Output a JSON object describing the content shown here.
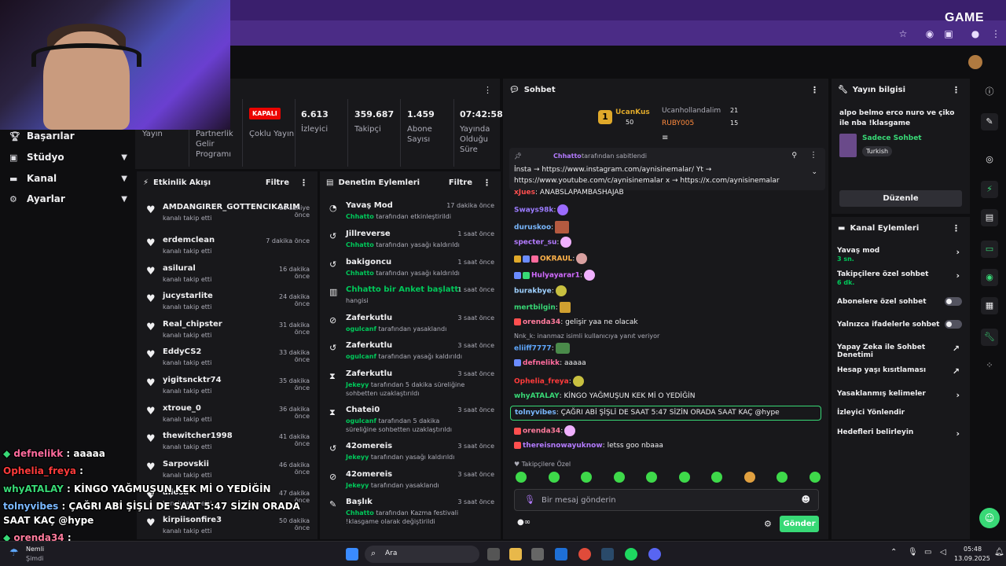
{
  "browser": {
    "logo_text": "GAME"
  },
  "leftnav": {
    "items": [
      {
        "label": "Başarılar",
        "icon": "trophy-icon"
      },
      {
        "label": "Stüdyo",
        "icon": "studio-icon"
      },
      {
        "label": "Kanal",
        "icon": "channel-icon"
      },
      {
        "label": "Ayarlar",
        "icon": "gear-icon"
      }
    ]
  },
  "stats": {
    "yayin": "Yayın",
    "partnerlik": "Partnerlik Gelir Programı",
    "kapali": "KAPALI",
    "coklu": "Çoklu Yayın",
    "izleyici_val": "6.613",
    "izleyici_lbl": "İzleyici",
    "takipci_val": "359.687",
    "takipci_lbl": "Takipçi",
    "abone_val": "1.459",
    "abone_lbl": "Abone Sayısı",
    "sure_val": "07:42:58",
    "sure_lbl": "Yayında Olduğu Süre"
  },
  "activity": {
    "title": "Etkinlik Akışı",
    "filter": "Filtre",
    "rows": [
      {
        "name": "AMDANGIRER_GOTTENCIKARIM",
        "sub": "kanalı takip etti",
        "time": "20 saniye önce"
      },
      {
        "name": "erdemclean",
        "sub": "kanalı takip etti",
        "time": "7 dakika önce"
      },
      {
        "name": "asilural",
        "sub": "kanalı takip etti",
        "time": "16 dakika önce"
      },
      {
        "name": "jucystarlite",
        "sub": "kanalı takip etti",
        "time": "24 dakika önce"
      },
      {
        "name": "Real_chipster",
        "sub": "kanalı takip etti",
        "time": "31 dakika önce"
      },
      {
        "name": "EddyCS2",
        "sub": "kanalı takip etti",
        "time": "33 dakika önce"
      },
      {
        "name": "yigitsncktr74",
        "sub": "kanalı takip etti",
        "time": "35 dakika önce"
      },
      {
        "name": "xtroue_0",
        "sub": "kanalı takip etti",
        "time": "36 dakika önce"
      },
      {
        "name": "thewitcher1998",
        "sub": "kanalı takip etti",
        "time": "41 dakika önce"
      },
      {
        "name": "Sarpovskii",
        "sub": "kanalı takip etti",
        "time": "46 dakika önce"
      },
      {
        "name": "aliosa",
        "sub": "kanalı takip etti",
        "time": "47 dakika önce"
      },
      {
        "name": "kirpiisonfire3",
        "sub": "kanalı takip etti",
        "time": "50 dakika önce"
      }
    ]
  },
  "moderation": {
    "title": "Denetim Eylemleri",
    "filter": "Filtre",
    "rows": [
      {
        "name": "Yavaş Mod",
        "actor": "Chhatto",
        "rest": "tarafından etkinleştirildi",
        "time": "17 dakika önce",
        "icon": "slow-mode-icon"
      },
      {
        "name": "Jillreverse",
        "actor": "Chhatto",
        "rest": "tarafından yasağı kaldırıldı",
        "time": "1 saat önce",
        "icon": "undo-icon"
      },
      {
        "name": "bakigoncu",
        "actor": "Chhatto",
        "rest": "tarafından yasağı kaldırıldı",
        "time": "1 saat önce",
        "icon": "undo-icon"
      },
      {
        "name": "Chhatto bir Anket başlattı",
        "actor": "",
        "rest": "hangisi",
        "time": "1 saat önce",
        "icon": "poll-icon"
      },
      {
        "name": "Zaferkutlu",
        "actor": "ogulcanf",
        "rest": "tarafından yasaklandı",
        "time": "3 saat önce",
        "icon": "ban-icon"
      },
      {
        "name": "Zaferkutlu",
        "actor": "ogulcanf",
        "rest": "tarafından yasağı kaldırıldı",
        "time": "3 saat önce",
        "icon": "undo-icon"
      },
      {
        "name": "Zaferkutlu",
        "actor": "Jekeyy",
        "rest": "tarafından 5 dakika süreliğine sohbetten uzaklaştırıldı",
        "time": "3 saat önce",
        "icon": "timeout-icon"
      },
      {
        "name": "Chatei0",
        "actor": "ogulcanf",
        "rest": "tarafından 5 dakika süreliğine sohbetten uzaklaştırıldı",
        "time": "3 saat önce",
        "icon": "timeout-icon"
      },
      {
        "name": "42omereis",
        "actor": "Jekeyy",
        "rest": "tarafından yasağı kaldırıldı",
        "time": "3 saat önce",
        "icon": "undo-icon"
      },
      {
        "name": "42omereis",
        "actor": "Jekeyy",
        "rest": "tarafından yasaklandı",
        "time": "3 saat önce",
        "icon": "ban-icon"
      },
      {
        "name": "Başlık",
        "actor": "Chhatto",
        "rest": "tarafından Kazma festivali !klasgame olarak değiştirildi",
        "time": "3 saat önce",
        "icon": "title-icon"
      }
    ]
  },
  "chat": {
    "title": "Sohbet",
    "leader1": {
      "name": "UcanKus",
      "count": "50"
    },
    "leader2": {
      "name": "Ucanhollandalim",
      "count": "21"
    },
    "leader3": {
      "name": "RUBY005",
      "count": "15"
    },
    "pinned_by": "Chhatto",
    "pinned_label": "tarafından sabitlendi",
    "pinned_line1": "İnsta → https://www.instagram.com/aynisinemalar/ Yt →",
    "pinned_line2": "https://www.youtube.com/c/aynisinemalar x → https://x.com/aynisinemalar",
    "messages": [
      {
        "user": "xJues",
        "color": "#ff4f4f",
        "text": ": ANABSLAPAMBASHAJAB"
      },
      {
        "user": "Sways98k",
        "color": "#9b7bff",
        "text": ":"
      },
      {
        "user": "duruskoo",
        "color": "#7ab8ff",
        "text": ":"
      },
      {
        "user": "specter_su",
        "color": "#b47bff",
        "text": ":"
      },
      {
        "user": "OKRAUL",
        "color": "#ffb24a",
        "text": ":"
      },
      {
        "user": "Hulyayarar1",
        "color": "#d16bff",
        "text": ":"
      },
      {
        "user": "burakbye",
        "color": "#9fd1ff",
        "text": ":"
      },
      {
        "user": "mertbilgin",
        "color": "#38d976",
        "text": ":"
      },
      {
        "user": "orenda34",
        "color": "#ff7b9c",
        "text": ": gelişir yaa ne olacak"
      },
      {
        "user": "eliiff7777",
        "color": "#5fa8ff",
        "text": ":"
      },
      {
        "user": "defnelikk",
        "color": "#ff6b9d",
        "text": ": aaaaa"
      },
      {
        "user": "Ophelia_freya",
        "color": "#ff3b3b",
        "text": ":"
      },
      {
        "user": "whyATALAY",
        "color": "#38d976",
        "text": ": KİNGO YAĞMUŞUN KEK Mİ O YEDİĞİN"
      },
      {
        "user": "tolnyvibes",
        "color": "#7ab8ff",
        "text": ": ÇAĞRI ABİ ŞİŞLİ DE SAAT 5:47 SİZİN ORADA SAAT KAÇ @hype"
      },
      {
        "user": "orenda34",
        "color": "#ff7b9c",
        "text": ":"
      },
      {
        "user": "thereisnowayuknow",
        "color": "#b47bff",
        "text": ": letss goo nbaaa"
      }
    ],
    "reply_hint": "Nnk_k: inanmaz isimli kullanıcıya yanıt veriyor",
    "followers_only": "Takipçilere Özel",
    "placeholder": "Bir mesaj gönderin",
    "send": "Gönder"
  },
  "info": {
    "title": "Yayın bilgisi",
    "stream_title": "alpo belmo erco nuro ve çiko ile nba !klasgame",
    "category": "Sadece Sohbet",
    "tag": "Turkish",
    "edit": "Düzenle"
  },
  "actions": {
    "title": "Kanal Eylemleri",
    "items": [
      {
        "label": "Yavaş mod",
        "sub": "3 sn."
      },
      {
        "label": "Takipçilere özel sohbet",
        "sub": "6 dk."
      },
      {
        "label": "Abonelere özel sohbet",
        "sub": ""
      },
      {
        "label": "Yalnızca ifadelerle sohbet",
        "sub": ""
      },
      {
        "label": "Yapay Zeka ile Sohbet Denetimi",
        "sub": ""
      },
      {
        "label": "Hesap yaşı kısıtlaması",
        "sub": ""
      },
      {
        "label": "Yasaklanmış kelimeler",
        "sub": ""
      },
      {
        "label": "İzleyici Yönlendir",
        "sub": ""
      },
      {
        "label": "Hedefleri belirleyin",
        "sub": ""
      }
    ]
  },
  "overlay": {
    "l1u": "defnelikk",
    "l1t": " : aaaaa",
    "l2u": "Ophelia_freya",
    "l2t": " :",
    "l3u": "whyATALAY",
    "l3t": " : KİNGO YAĞMUŞUN KEK Mİ O YEDİĞİN",
    "l4u": "tolnyvibes",
    "l4t": " : ÇAĞRI ABİ ŞİŞLİ DE SAAT 5:47 SİZİN ORADA",
    "l5t": "SAAT KAÇ @hype",
    "l6u": "orenda34",
    "l6t": " :"
  },
  "taskbar": {
    "weather": "Nemli",
    "weather_sub": "Şimdi",
    "search": "Ara",
    "time": "05:48",
    "date": "13.09.2025"
  }
}
